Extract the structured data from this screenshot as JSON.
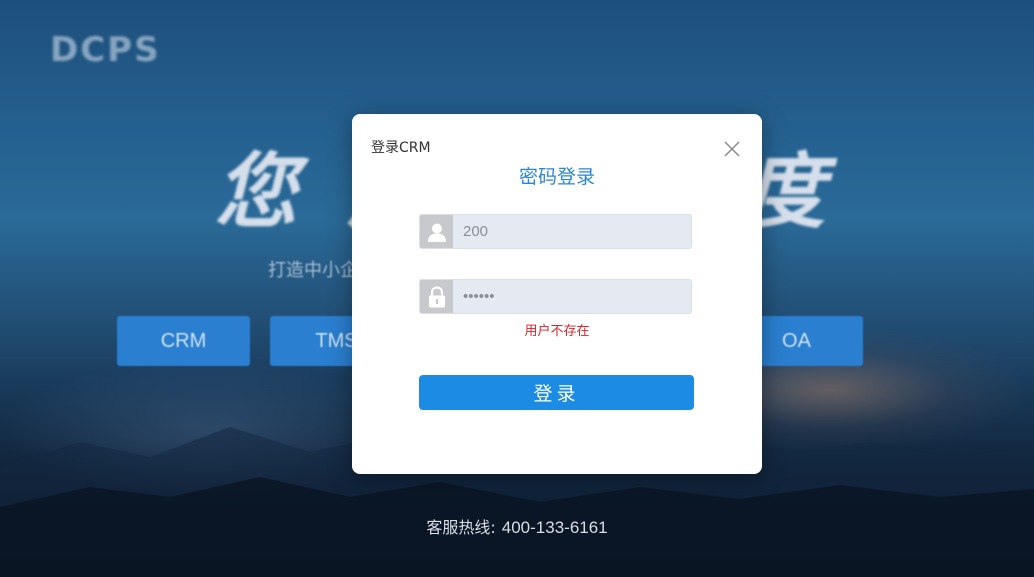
{
  "background": {
    "logo": "DCPS",
    "slogan": "您成功速度",
    "subline": "打造中小企业数字化管理平台",
    "tiles": [
      {
        "label": "CRM"
      },
      {
        "label": "TMS"
      },
      {
        "label": "OA"
      }
    ],
    "hotline_label": "客服热线:",
    "hotline_number": "400-133-6161"
  },
  "modal": {
    "title": "登录CRM",
    "heading": "密码登录",
    "username": {
      "value": "200",
      "icon": "user-icon"
    },
    "password": {
      "value": "123456",
      "icon": "lock-icon"
    },
    "error": "用户不存在",
    "submit_label": "登录"
  },
  "colors": {
    "accent": "#1c8be3",
    "heading": "#2a86d6",
    "error": "#d9222a"
  }
}
